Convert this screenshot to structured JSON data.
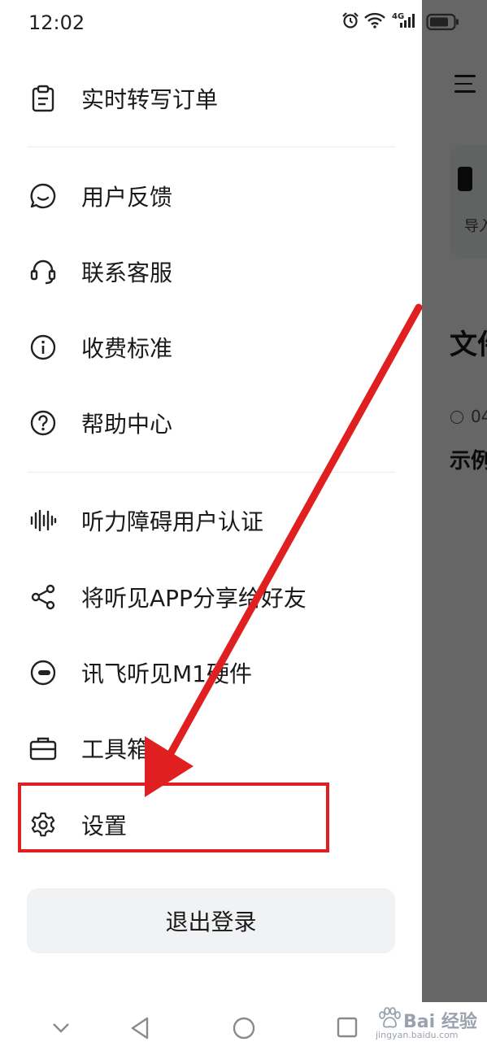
{
  "status_bar": {
    "time": "12:02",
    "network": "4G"
  },
  "menu": {
    "items": [
      {
        "icon": "clipboard-icon",
        "label": "实时转写订单"
      },
      {
        "icon": "feedback-icon",
        "label": "用户反馈"
      },
      {
        "icon": "headset-icon",
        "label": "联系客服"
      },
      {
        "icon": "info-icon",
        "label": "收费标准"
      },
      {
        "icon": "question-icon",
        "label": "帮助中心"
      },
      {
        "icon": "soundwave-icon",
        "label": "听力障碍用户认证"
      },
      {
        "icon": "share-icon",
        "label": "将听见APP分享给好友"
      },
      {
        "icon": "device-icon",
        "label": "讯飞听见M1硬件"
      },
      {
        "icon": "toolbox-icon",
        "label": "工具箱"
      },
      {
        "icon": "gear-icon",
        "label": "设置"
      }
    ],
    "logout_label": "退出登录"
  },
  "background_app": {
    "card_label": "导入",
    "section_title": "文件",
    "meta": "04",
    "doc_title": "示例"
  },
  "watermark": {
    "main": "Bai 经验",
    "sub": "jingyan.baidu.com"
  },
  "annotation_color": "#e02020"
}
